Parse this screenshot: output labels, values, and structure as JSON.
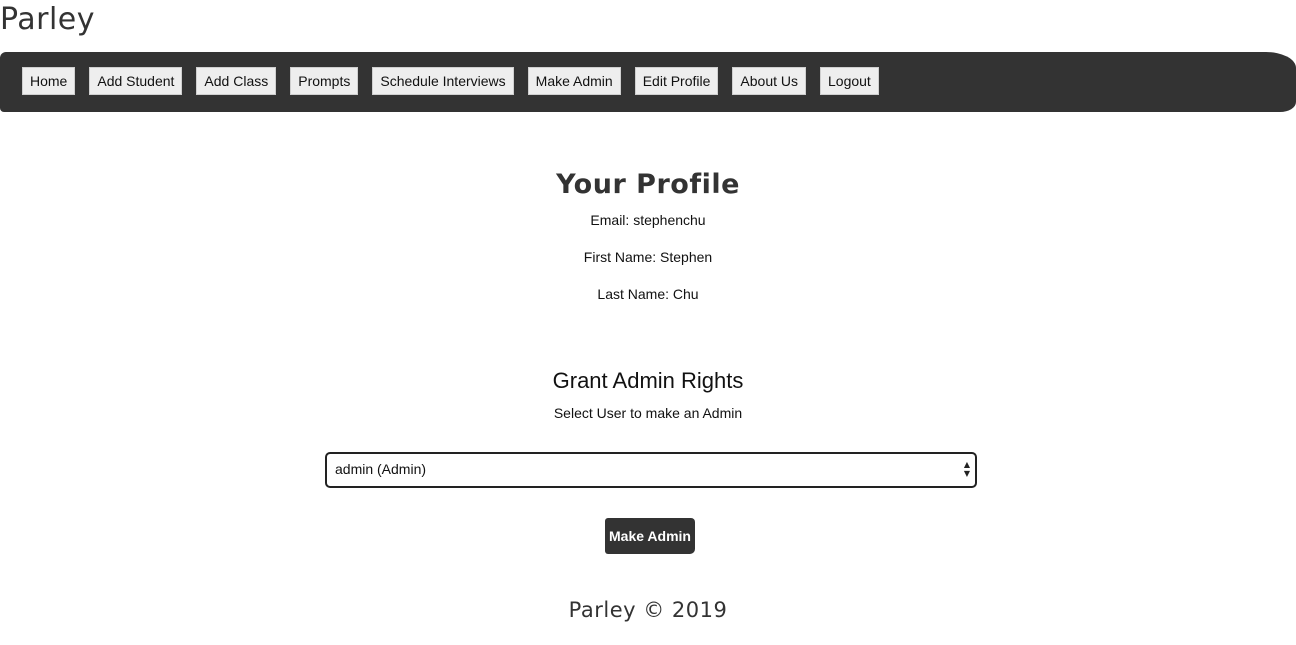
{
  "app": {
    "brand": "Parley"
  },
  "nav": {
    "items": [
      {
        "label": "Home"
      },
      {
        "label": "Add Student"
      },
      {
        "label": "Add Class"
      },
      {
        "label": "Prompts"
      },
      {
        "label": "Schedule Interviews"
      },
      {
        "label": "Make Admin"
      },
      {
        "label": "Edit Profile"
      },
      {
        "label": "About Us"
      },
      {
        "label": "Logout"
      }
    ]
  },
  "profile": {
    "title": "Your Profile",
    "email": "Email: stephenchu",
    "first_name": "First Name: Stephen",
    "last_name": "Last Name: Chu"
  },
  "admin": {
    "title": "Grant Admin Rights",
    "select_label": "Select User to make an Admin",
    "selected_user": "admin (Admin)",
    "submit_label": "Make Admin"
  },
  "footer": {
    "text": "Parley © 2019"
  },
  "colors": {
    "navbar": "#333333",
    "nav_button": "#eeeeee",
    "primary_button": "#333333"
  }
}
